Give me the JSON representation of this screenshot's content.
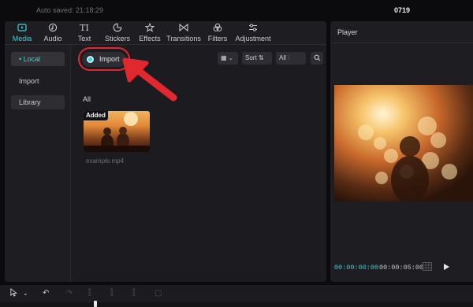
{
  "title_bar": {
    "autosaved": "Auto saved: 21:18:29",
    "project_name": "0719"
  },
  "toolbar": {
    "items": [
      {
        "label": "Media",
        "icon": "media-icon",
        "active": true
      },
      {
        "label": "Audio",
        "icon": "audio-icon",
        "active": false
      },
      {
        "label": "Text",
        "icon": "text-icon",
        "active": false
      },
      {
        "label": "Stickers",
        "icon": "stickers-icon",
        "active": false
      },
      {
        "label": "Effects",
        "icon": "effects-icon",
        "active": false
      },
      {
        "label": "Transitions",
        "icon": "transitions-icon",
        "active": false
      },
      {
        "label": "Filters",
        "icon": "filters-icon",
        "active": false
      },
      {
        "label": "Adjustment",
        "icon": "adjustment-icon",
        "active": false
      }
    ]
  },
  "subnav": {
    "items": [
      {
        "label": "• Local",
        "active": true
      },
      {
        "label": "Import",
        "active": false
      },
      {
        "label": "Library",
        "active": false
      }
    ]
  },
  "media": {
    "import_label": "Import",
    "sort_label": "Sort",
    "filter_label": "All",
    "tab_all": "All",
    "clip": {
      "badge": "Added",
      "name": "example.mp4"
    }
  },
  "player": {
    "title": "Player",
    "time_current": "00:00:00:00",
    "time_total": "00:00:05:00"
  },
  "colors": {
    "accent": "#3ad0d6",
    "annotation_red": "#e0282e",
    "panel_bg": "#1e1e22"
  }
}
